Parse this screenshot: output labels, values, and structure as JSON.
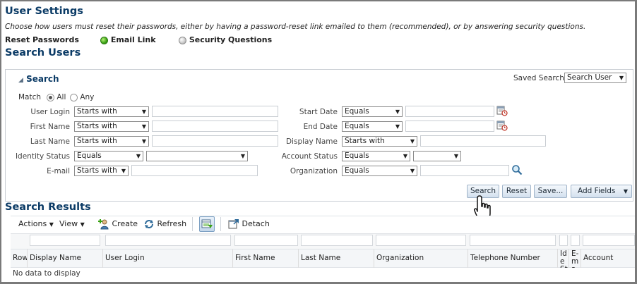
{
  "page": {
    "title": "User Settings",
    "description": "Choose how users must reset their passwords, either by having a password-reset link emailed to them (recommended), or by answering security questions.",
    "reset_passwords_label": "Reset Passwords",
    "reset_options": [
      "Email Link",
      "Security Questions"
    ],
    "search_users_title": "Search Users"
  },
  "search_panel": {
    "title": "Search",
    "saved_search_label": "Saved Search",
    "saved_search_value": "Search User",
    "match_label": "Match",
    "match_all": "All",
    "match_any": "Any",
    "fields_left": [
      {
        "label": "User Login",
        "operator": "Starts with"
      },
      {
        "label": "First Name",
        "operator": "Starts with"
      },
      {
        "label": "Last Name",
        "operator": "Starts with"
      },
      {
        "label": "Identity Status",
        "operator": "Equals"
      },
      {
        "label": "E-mail",
        "operator": "Starts with"
      }
    ],
    "fields_right": [
      {
        "label": "Start Date",
        "operator": "Equals"
      },
      {
        "label": "End Date",
        "operator": "Equals"
      },
      {
        "label": "Display Name",
        "operator": "Starts with"
      },
      {
        "label": "Account Status",
        "operator": "Equals"
      },
      {
        "label": "Organization",
        "operator": "Equals"
      }
    ],
    "buttons": {
      "search": "Search",
      "reset": "Reset",
      "save": "Save...",
      "add_fields": "Add Fields"
    }
  },
  "results": {
    "title": "Search Results",
    "toolbar": {
      "actions": "Actions",
      "view": "View",
      "create": "Create",
      "refresh": "Refresh",
      "detach": "Detach"
    },
    "columns": [
      "Row",
      "Display Name",
      "User Login",
      "First Name",
      "Last Name",
      "Organization",
      "Telephone Number",
      "Ide Sta",
      "E-ma",
      "Account Status"
    ],
    "empty_text": "No data to display"
  },
  "colors": {
    "title": "#0b3b66",
    "radio_selected": "#3aa114",
    "button_gradient_top": "#f4f8fc",
    "button_gradient_bottom": "#d3e0ee"
  }
}
